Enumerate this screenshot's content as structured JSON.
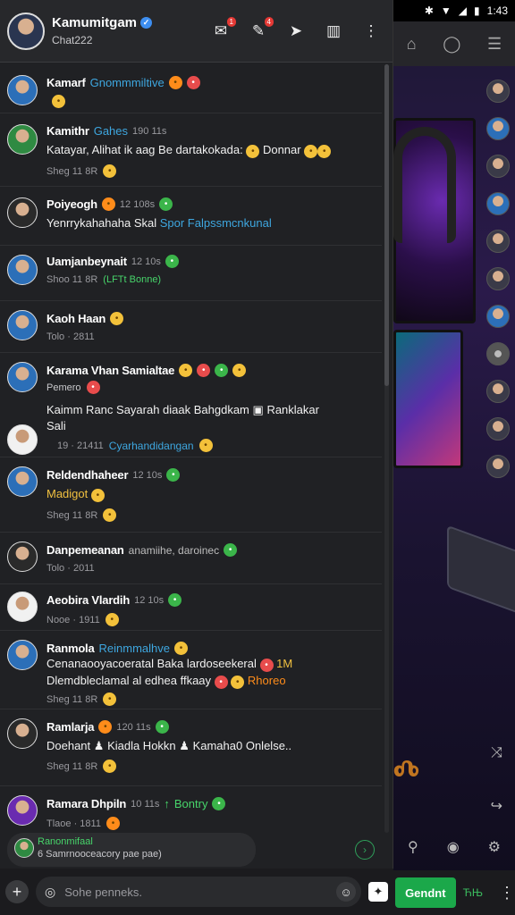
{
  "status_bar": {
    "bluetooth": "✱",
    "wifi": "▼",
    "signal": "◢",
    "battery": "▮",
    "time": "1:43"
  },
  "header": {
    "title": "Kamumitgam",
    "subtitle": "Chat222",
    "badge_inbox": "1",
    "badge_mentions": "4"
  },
  "messages": [
    {
      "name": "Kamarf",
      "role": "Gnommmiltive",
      "text": "",
      "meta": ""
    },
    {
      "name": "Kamithr",
      "role": "Gahes",
      "time": "190 11s",
      "text": "Katayar, Alihat ik aag Be dartakokada:",
      "text_tail": "Donnar",
      "meta": "Sheg 11 8R"
    },
    {
      "name": "Poiyeogh",
      "time": "12 108s",
      "text": "Yenrrykahahaha Skal",
      "text_link": "Spor Falpssmcnkunal",
      "meta": ""
    },
    {
      "name": "Uamjanbeynait",
      "time": "12 10s",
      "meta": "Shoo 11 8R",
      "meta_green": "(LFTt Bonne)"
    },
    {
      "name": "Kaoh Haan",
      "meta": "Tolo · 2811"
    },
    {
      "name": "Karama Vhan Samialtae",
      "sub": "Pemero",
      "text": "Kaimm Ranc Sayarah diaak Bahgdkam",
      "text_tail": "Ranklakar",
      "text2": "Sali",
      "meta": "19 · 21411",
      "meta_link": "Cyarhandidangan"
    },
    {
      "name": "Reldendhaheer",
      "time": "12 10s",
      "text": "Madigot",
      "meta": "Sheg 11 8R"
    },
    {
      "name": "Danpemeanan",
      "muted": "anamiihe, daroinec",
      "meta": "Tolo · 2011"
    },
    {
      "name": "Aeobira Vlardih",
      "time": "12 10s",
      "meta": "Nooe · 1911"
    },
    {
      "name": "Ranmola",
      "role": "Reinmmalhve",
      "text": "Cenanaooyacoeratal Baka lardoseekeral",
      "text_tail": "1M",
      "text2": "Dlemdbleclamal al edhea ffkaay",
      "text2_tail": "Rhoreo",
      "meta": "Sheg 11 8R"
    },
    {
      "name": "Ramlarja",
      "time": "120 11s",
      "text": "Doehant",
      "text_mid": "Kiadla Hokkn",
      "text_tail": "Kamaha0 Onlelse..",
      "meta": "Sheg 11 8R"
    },
    {
      "name": "Ramara Dhpiln",
      "time": "10 11s",
      "role": "Bontry",
      "meta": "Tlaoe · 1811"
    }
  ],
  "reply": {
    "name": "Ranonmifaal",
    "text": "6 Samrnooceacory pae pae)"
  },
  "composer": {
    "placeholder": "Sohe penneks."
  },
  "right_panel": {
    "send_label": "Gendnt",
    "extra_label": "ЋЊ",
    "glyph": "Ⰴ"
  }
}
